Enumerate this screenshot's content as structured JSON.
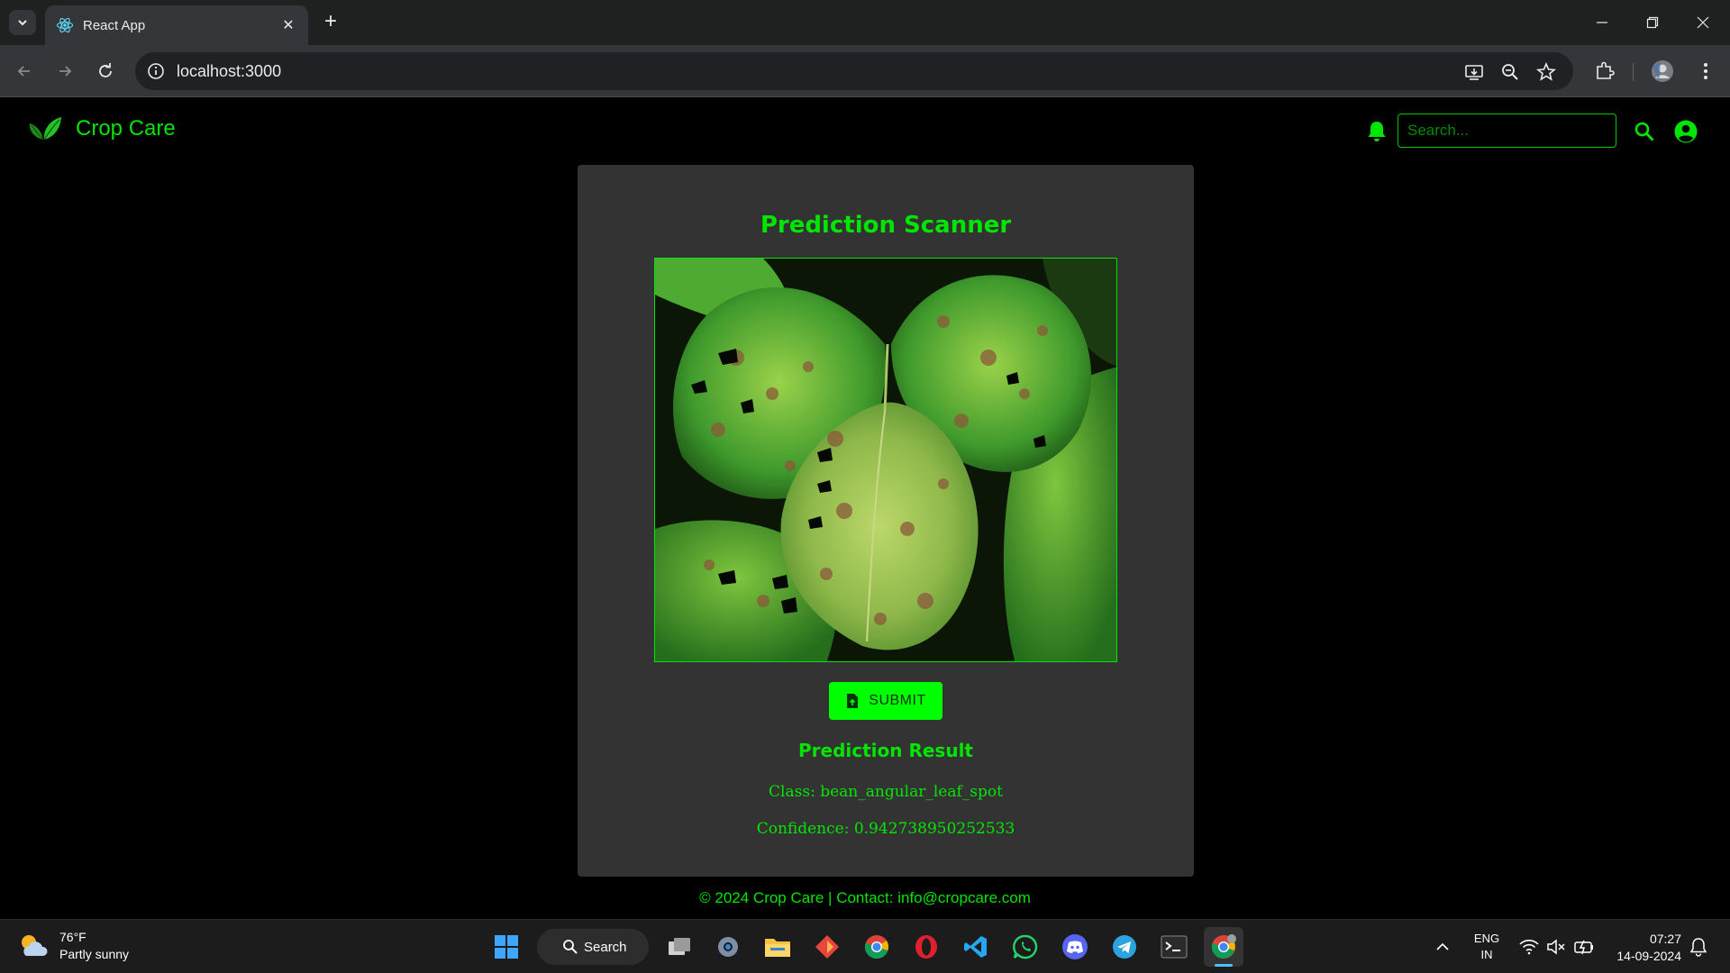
{
  "browser": {
    "tab_title": "React App",
    "url": "localhost:3000"
  },
  "app": {
    "brand_name": "Crop Care",
    "search_placeholder": "Search..."
  },
  "card": {
    "title": "Prediction Scanner",
    "submit_label": "SUBMIT",
    "result_title": "Prediction Result",
    "class_line": "Class: bean_angular_leaf_spot",
    "confidence_line": "Confidence: 0.942738950252533"
  },
  "footer": {
    "text": "© 2024 Crop Care | Contact: info@cropcare.com"
  },
  "taskbar": {
    "weather_temp": "76°F",
    "weather_desc": "Partly sunny",
    "search_label": "Search",
    "lang_line1": "ENG",
    "lang_line2": "IN",
    "time": "07:27",
    "date": "14-09-2024"
  },
  "colors": {
    "accent": "#00e600",
    "button": "#00ff00",
    "card_bg": "#333333",
    "page_bg": "#000000"
  },
  "icons": [
    "react-favicon",
    "back-icon",
    "forward-icon",
    "reload-icon",
    "info-icon",
    "install-icon",
    "zoom-icon",
    "star-icon",
    "extensions-icon",
    "profile-icon",
    "menu-icon",
    "leaf-logo",
    "bell-icon",
    "search-icon",
    "account-icon",
    "upload-file-icon"
  ]
}
